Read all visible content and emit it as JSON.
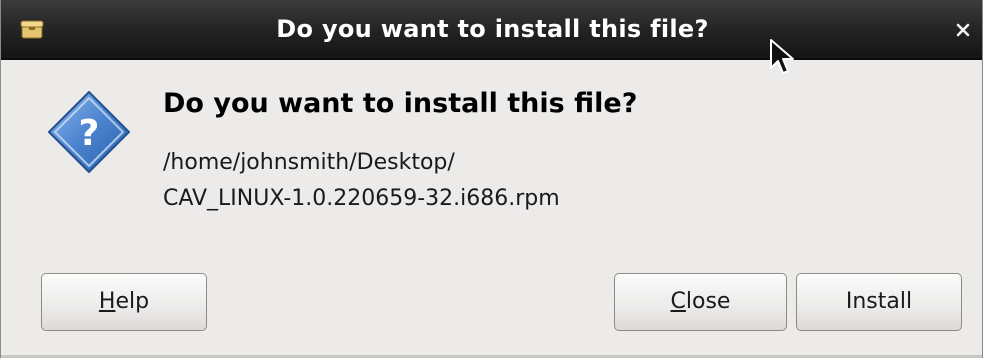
{
  "window": {
    "title": "Do you want to install this file?",
    "app_icon": "package-icon",
    "close_icon": "close-icon"
  },
  "dialog": {
    "icon": "question-icon",
    "heading": "Do you want to install this file?",
    "path_line1": "/home/johnsmith/Desktop/",
    "path_line2": "CAV_LINUX-1.0.220659-32.i686.rpm"
  },
  "buttons": {
    "help": {
      "mnemonic": "H",
      "rest": "elp"
    },
    "close": {
      "mnemonic": "C",
      "rest": "lose"
    },
    "install": {
      "label": "Install"
    }
  },
  "colors": {
    "titlebar": "#222222",
    "background": "#edebe9",
    "icon_blue": "#3f79c5"
  }
}
